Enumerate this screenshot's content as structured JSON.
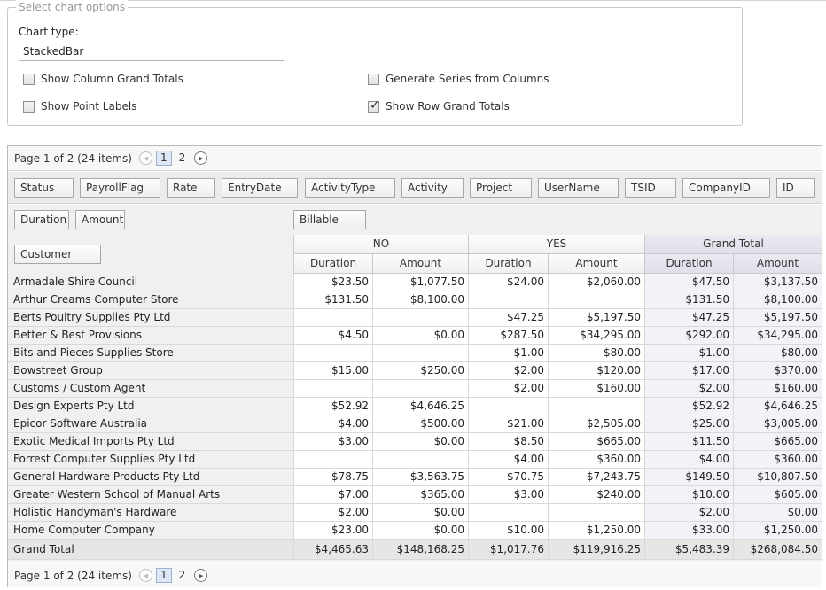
{
  "options": {
    "legend": "Select chart options",
    "chart_type_label": "Chart type:",
    "chart_type_value": "StackedBar",
    "show_column_grand_totals": {
      "label": "Show Column Grand Totals",
      "checked": false
    },
    "generate_series_from_columns": {
      "label": "Generate Series from Columns",
      "checked": false
    },
    "show_point_labels": {
      "label": "Show Point Labels",
      "checked": false
    },
    "show_row_grand_totals": {
      "label": "Show Row Grand Totals",
      "checked": true
    }
  },
  "pager": {
    "text": "Page 1 of 2 (24 items)",
    "pages": [
      "1",
      "2"
    ],
    "current": "1"
  },
  "filter_fields": [
    "Status",
    "PayrollFlag",
    "Rate",
    "EntryDate",
    "ActivityType",
    "Activity",
    "Project",
    "UserName",
    "TSID",
    "CompanyID",
    "ID"
  ],
  "data_fields": [
    "Duration",
    "Amount"
  ],
  "column_field": "Billable",
  "row_field": "Customer",
  "column_groups": [
    "NO",
    "YES",
    "Grand Total"
  ],
  "measure_headers": [
    "Duration",
    "Amount",
    "Duration",
    "Amount",
    "Duration",
    "Amount"
  ],
  "rows": [
    {
      "name": "Armadale Shire Council",
      "values": [
        "$23.50",
        "$1,077.50",
        "$24.00",
        "$2,060.00",
        "$47.50",
        "$3,137.50"
      ]
    },
    {
      "name": "Arthur Creams Computer Store",
      "values": [
        "$131.50",
        "$8,100.00",
        "",
        "",
        "$131.50",
        "$8,100.00"
      ]
    },
    {
      "name": "Berts Poultry Supplies Pty Ltd",
      "values": [
        "",
        "",
        "$47.25",
        "$5,197.50",
        "$47.25",
        "$5,197.50"
      ]
    },
    {
      "name": "Better & Best Provisions",
      "values": [
        "$4.50",
        "$0.00",
        "$287.50",
        "$34,295.00",
        "$292.00",
        "$34,295.00"
      ]
    },
    {
      "name": "Bits and Pieces Supplies Store",
      "values": [
        "",
        "",
        "$1.00",
        "$80.00",
        "$1.00",
        "$80.00"
      ]
    },
    {
      "name": "Bowstreet Group",
      "values": [
        "$15.00",
        "$250.00",
        "$2.00",
        "$120.00",
        "$17.00",
        "$370.00"
      ]
    },
    {
      "name": "Customs / Custom Agent",
      "values": [
        "",
        "",
        "$2.00",
        "$160.00",
        "$2.00",
        "$160.00"
      ]
    },
    {
      "name": "Design Experts Pty Ltd",
      "values": [
        "$52.92",
        "$4,646.25",
        "",
        "",
        "$52.92",
        "$4,646.25"
      ]
    },
    {
      "name": "Epicor Software Australia",
      "values": [
        "$4.00",
        "$500.00",
        "$21.00",
        "$2,505.00",
        "$25.00",
        "$3,005.00"
      ]
    },
    {
      "name": "Exotic Medical Imports Pty Ltd",
      "values": [
        "$3.00",
        "$0.00",
        "$8.50",
        "$665.00",
        "$11.50",
        "$665.00"
      ]
    },
    {
      "name": "Forrest Computer Supplies Pty Ltd",
      "values": [
        "",
        "",
        "$4.00",
        "$360.00",
        "$4.00",
        "$360.00"
      ]
    },
    {
      "name": "General Hardware Products Pty Ltd",
      "values": [
        "$78.75",
        "$3,563.75",
        "$70.75",
        "$7,243.75",
        "$149.50",
        "$10,807.50"
      ]
    },
    {
      "name": "Greater Western School of Manual Arts",
      "values": [
        "$7.00",
        "$365.00",
        "$3.00",
        "$240.00",
        "$10.00",
        "$605.00"
      ]
    },
    {
      "name": "Holistic Handyman's Hardware",
      "values": [
        "$2.00",
        "$0.00",
        "",
        "",
        "$2.00",
        "$0.00"
      ]
    },
    {
      "name": "Home Computer Company",
      "values": [
        "$23.00",
        "$0.00",
        "$10.00",
        "$1,250.00",
        "$33.00",
        "$1,250.00"
      ]
    }
  ],
  "grand_total": {
    "name": "Grand Total",
    "values": [
      "$4,465.63",
      "$148,168.25",
      "$1,017.76",
      "$119,916.25",
      "$5,483.39",
      "$268,084.50"
    ]
  }
}
